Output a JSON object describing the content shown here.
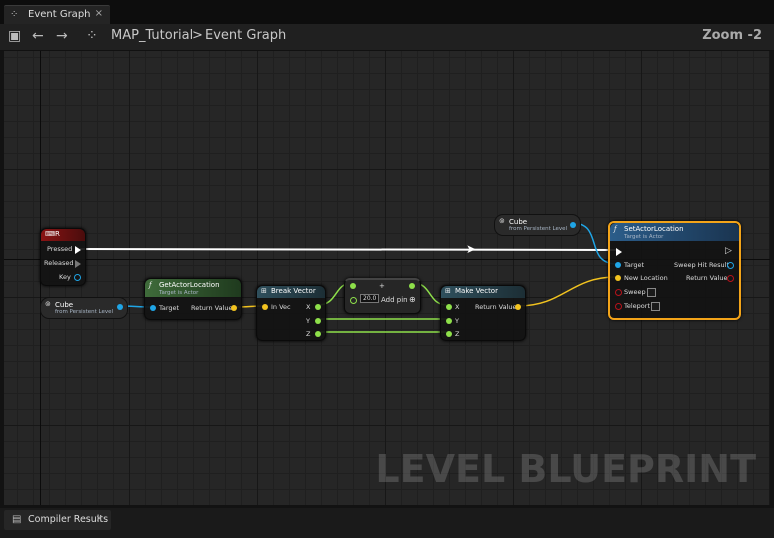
{
  "tab": {
    "label": "Event Graph",
    "close": "×"
  },
  "breadcrumb": {
    "root": "MAP_Tutorial",
    "separator": ">",
    "current": "Event Graph"
  },
  "zoom_label": "Zoom -2",
  "nodes": {
    "key_event": {
      "title": "R",
      "pins": [
        "Pressed",
        "Released",
        "Key"
      ]
    },
    "cube_ref_top": {
      "title": "Cube",
      "subtitle": "from Persistent Level"
    },
    "cube_ref_left": {
      "title": "Cube",
      "subtitle": "from Persistent Level"
    },
    "get_actor_location": {
      "title": "GetActorLocation",
      "subtitle": "Target is Actor",
      "in_pin": "Target",
      "out_pin": "Return Value"
    },
    "break_vector": {
      "title": "Break Vector",
      "in_pin": "In Vec",
      "out_pins": [
        "X",
        "Y",
        "Z"
      ]
    },
    "add_node": {
      "value": "20.0",
      "add_pin_label": "Add pin",
      "op": "+"
    },
    "make_vector": {
      "title": "Make Vector",
      "in_pins": [
        "X",
        "Y",
        "Z"
      ],
      "out_pin": "Return Value"
    },
    "set_actor_location": {
      "title": "SetActorLocation",
      "subtitle": "Target is Actor",
      "left_pins": [
        "Target",
        "New Location",
        "Sweep",
        "Teleport"
      ],
      "right_pins": [
        "Sweep Hit Result",
        "Return Value"
      ]
    }
  },
  "watermark": "LEVEL BLUEPRINT",
  "bottom_tab": {
    "label": "Compiler Results",
    "close": "×"
  },
  "colors": {
    "exec": "#ffffff",
    "object_pin": "#1fa5e6",
    "vector_pin": "#f2c31f",
    "float_pin": "#8ee04a",
    "event_header": "#8a1414",
    "pure_header": "#3f6b3a",
    "vector_header": "#2f4f5c",
    "call_header": "#2b5d8a",
    "selected_border": "#f3a419"
  }
}
